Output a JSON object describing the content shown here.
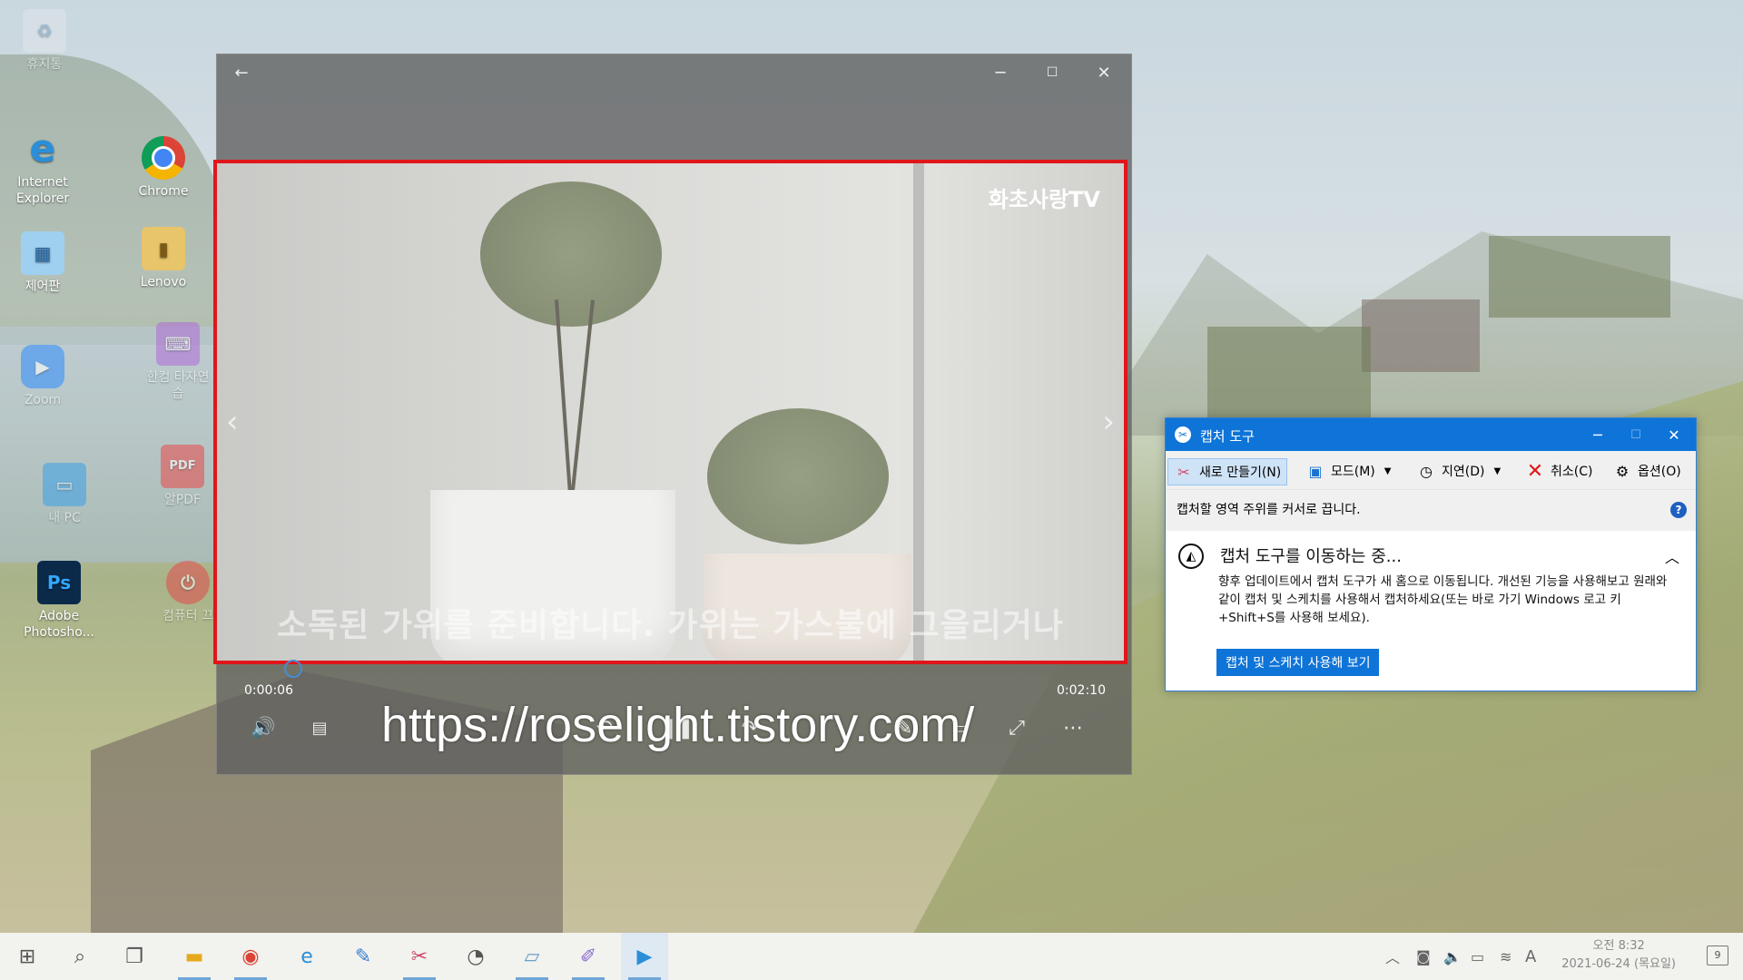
{
  "desktop_icons": [
    {
      "label": "휴지통",
      "icon": "recycle-bin-icon"
    },
    {
      "label": "Internet Explorer",
      "icon": "internet-explorer-icon"
    },
    {
      "label": "Chrome",
      "icon": "chrome-icon"
    },
    {
      "label": "제어판",
      "icon": "control-panel-icon"
    },
    {
      "label": "Lenovo",
      "icon": "lenovo-folder-icon"
    },
    {
      "label": "Zoom",
      "icon": "zoom-icon"
    },
    {
      "label": "한컴 타자연습",
      "icon": "hancom-typing-icon"
    },
    {
      "label": "내 PC",
      "icon": "this-pc-icon"
    },
    {
      "label": "알PDF",
      "icon": "alpdf-icon"
    },
    {
      "label": "Adobe Photosho...",
      "icon": "photoshop-icon"
    },
    {
      "label": "컴퓨터 끄",
      "icon": "shutdown-icon"
    }
  ],
  "player": {
    "back_icon": "arrow-left-icon",
    "watermark": "화초사랑TV",
    "subtitle": "소독된 가위를 준비합니다. 가위는 가스불에 그을리거나",
    "time_current": "0:00:06",
    "time_total": "0:02:10",
    "progress_fraction": 0.046,
    "url_overlay": "https://roselight.tistory.com/"
  },
  "snip": {
    "title": "캡처 도구",
    "tools": {
      "new": "새로 만들기(N)",
      "mode": "모드(M)",
      "delay": "지연(D)",
      "cancel": "취소(C)",
      "options": "옵션(O)"
    },
    "hint": "캡처할 영역 주위를 커서로 끕니다.",
    "panel_title": "캡처 도구를 이동하는 중...",
    "panel_body": "향후 업데이트에서 캡처 도구가 새 홈으로 이동됩니다. 개선된 기능을 사용해보고 원래와 같이 캡처 및 스케치를 사용해서 캡처하세요(또는 바로 가기 Windows 로고 키+Shift+S를 사용해 보세요).",
    "cta": "캡처 및 스케치 사용해 보기",
    "accent": "#0f74d8"
  },
  "taskbar": {
    "clock_time": "오전 8:32",
    "clock_date": "2021-06-24 (목요일)",
    "ime": "A",
    "notifications": "9"
  }
}
